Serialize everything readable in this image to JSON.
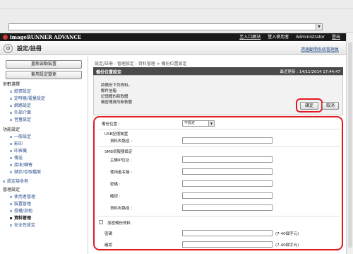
{
  "header": {
    "brand": "imageRUNNER ADVANCE",
    "links": [
      "至入口網站",
      "登入使用者",
      "Administrator",
      "登出"
    ]
  },
  "titlebar": {
    "title": "設定/註冊",
    "mgmt_link": "週邊斷開系統管理員"
  },
  "sidebar": {
    "buttons": [
      "重新啟動裝置",
      "套用設定變更"
    ],
    "groups": [
      {
        "heading": "參數選擇",
        "items": [
          "紙張設定",
          "定時器/電量設定",
          "網路設定",
          "外部介面",
          "音量設定"
        ]
      },
      {
        "heading": "功能設定",
        "items": [
          "一般設定",
          "影印",
          "印表機",
          "傳送",
          "接收/轉寄",
          "儲存/存取檔案"
        ]
      },
      {
        "heading": "設定接收者",
        "items": []
      },
      {
        "heading": "管理設定",
        "items": [
          "使用者管理",
          "裝置管理",
          "授權/其他",
          "資料管理",
          "安全性設定"
        ]
      }
    ],
    "active_item": "資料管理"
  },
  "main": {
    "breadcrumb": "設定/註冊 : 管理設定 : 資料管理 > 備份位置設定",
    "section_title": "備份位置設定",
    "last_updated": "最近更新 : 14/11/2014 17:44:47",
    "info_lines": [
      "將備份下列資料。",
      "郵件信箱",
      "記憶體的新軟體",
      "機密傳真的新軟體"
    ],
    "ok_button": "確定",
    "cancel_button": "取消",
    "form": {
      "backup_location_label": "備份位置 :",
      "backup_location_value": "不設定",
      "usb_heading": "USB記憶裝置",
      "usb_folder_label": "資料夾路徑 :",
      "smb_heading": "SMB伺服器設定",
      "host_label": "主機IP位址 :",
      "username_label": "使用者名稱 :",
      "password_label": "密碼 :",
      "confirm_label": "確認 :",
      "smb_folder_label": "資料夾路徑 :",
      "encrypt_label": "加密備份資料",
      "enc_password_label": "密碼",
      "enc_confirm_label": "確認",
      "length_hint": "(7-40個字元)"
    }
  },
  "colors": {
    "header_bg": "#1a1a1a",
    "section_header_bg": "#4a4a4a",
    "highlight_red": "#e21a23",
    "link_blue": "#2a4f8a"
  }
}
